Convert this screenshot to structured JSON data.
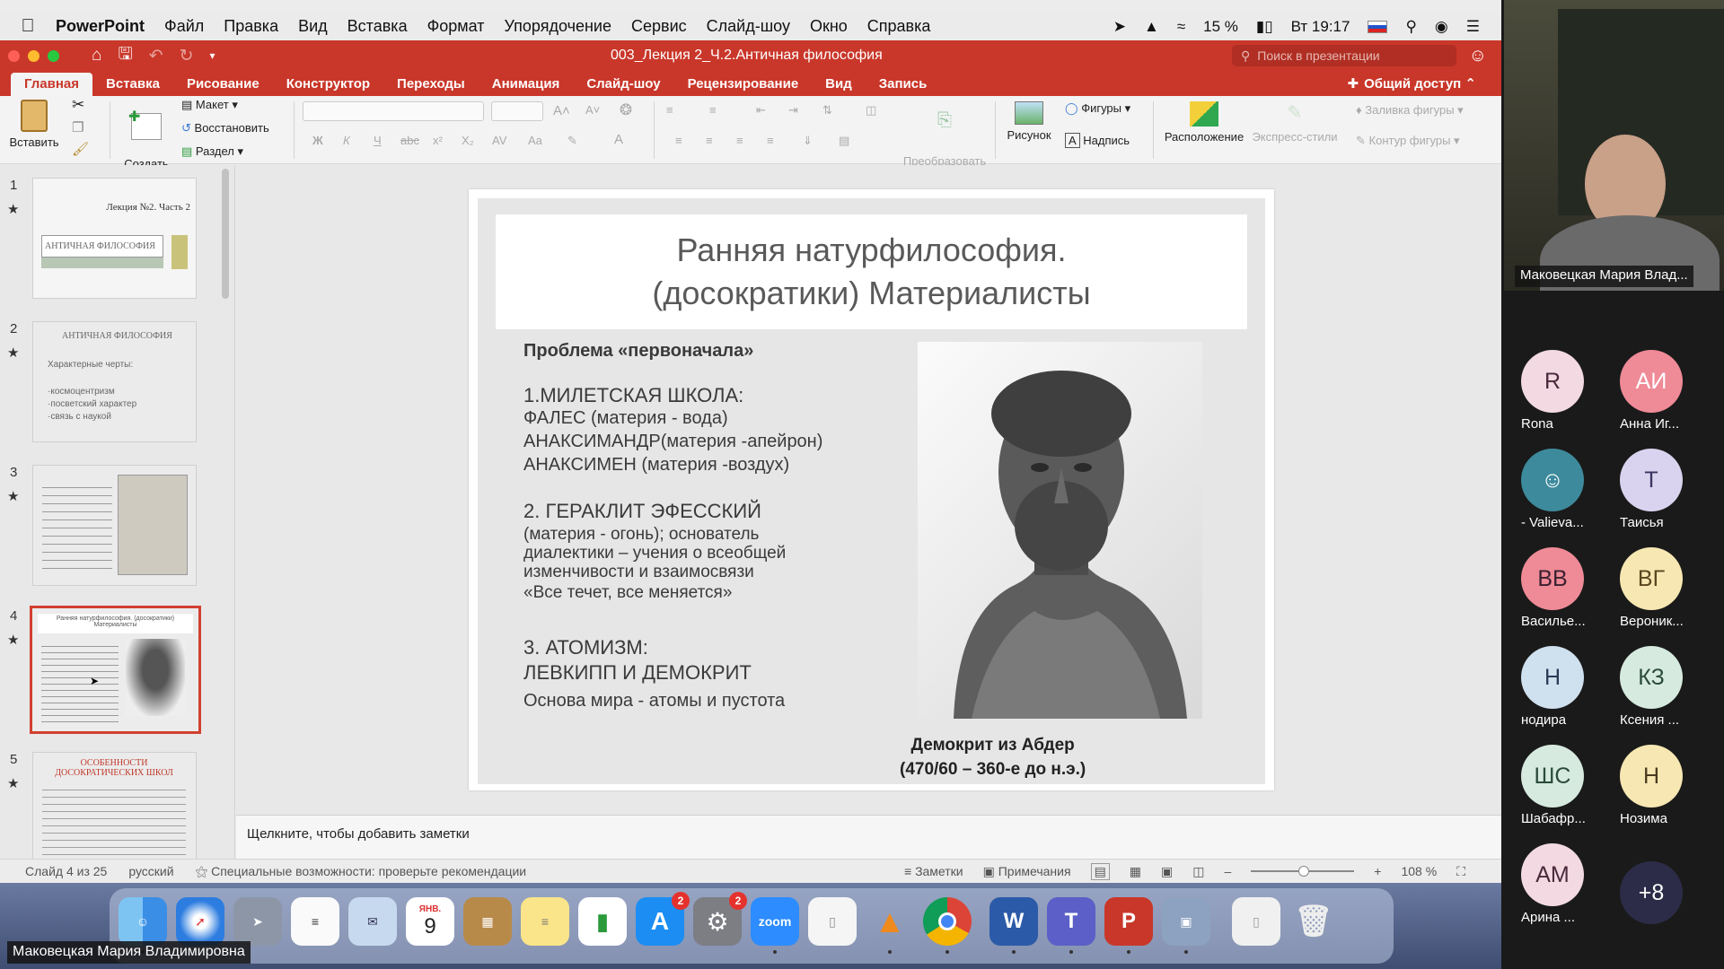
{
  "menubar": {
    "app": "PowerPoint",
    "items": [
      "Файл",
      "Правка",
      "Вид",
      "Вставка",
      "Формат",
      "Упорядочение",
      "Сервис",
      "Слайд-шоу",
      "Окно",
      "Справка"
    ],
    "battery": "15 %",
    "clock": "Вт 19:17"
  },
  "titlebar": {
    "title": "003_Лекция 2_Ч.2.Античная философия",
    "search_placeholder": "Поиск в презентации"
  },
  "ribbon": {
    "tabs": [
      "Главная",
      "Вставка",
      "Рисование",
      "Конструктор",
      "Переходы",
      "Анимация",
      "Слайд-шоу",
      "Рецензирование",
      "Вид",
      "Запись"
    ],
    "share": "Общий доступ",
    "paste": "Вставить",
    "new_slide": "Создать\nслайд",
    "layout": "Макет",
    "reset": "Восстановить",
    "section": "Раздел",
    "smartart": "Преобразовать\nв SmartArt",
    "picture": "Рисунок",
    "shapes": "Фигуры",
    "textbox": "Надпись",
    "arrange": "Расположение",
    "quick_styles": "Экспресс-стили",
    "shape_fill": "Заливка фигуры",
    "shape_outline": "Контур фигуры",
    "font_buttons": [
      "Ж",
      "К",
      "Ч",
      "abc",
      "x²",
      "X₂"
    ]
  },
  "thumbnails": [
    {
      "num": "1",
      "lines": [
        "Лекция №2. Часть 2",
        "АНТИЧНАЯ ФИЛОСОФИЯ"
      ]
    },
    {
      "num": "2",
      "lines": [
        "АНТИЧНАЯ ФИЛОСОФИЯ",
        "Характерные черты:",
        "·космоцентризм",
        "·посветский характер",
        "·связь с наукой"
      ]
    },
    {
      "num": "3",
      "lines": []
    },
    {
      "num": "4",
      "lines": [
        "Ранняя натурфилософия. (досократики) Материалисты"
      ]
    },
    {
      "num": "5",
      "lines": [
        "ОСОБЕННОСТИ ДОСОКРАТИЧЕСКИХ ШКОЛ"
      ]
    }
  ],
  "slide": {
    "title1": "Ранняя натурфилософия.",
    "title2": "(досократики)  Материалисты",
    "problem": "Проблема «первоначала»",
    "s1_head": "1.МИЛЕТСКАЯ ШКОЛА:",
    "s1_l1": "ФАЛЕС (материя - вода)",
    "s1_l2": "АНАКСИМАНДР(материя -апейрон)",
    "s1_l3": " АНАКСИМЕН (материя -воздух)",
    "s2_head": "2. ГЕРАКЛИТ ЭФЕССКИЙ",
    "s2_l1": "(материя - огонь); основатель",
    "s2_l2": " диалектики – учения о всеобщей",
    "s2_l3": " изменчивости и взаимосвязи",
    "s2_l4": "«Все течет, все меняется»",
    "s3_head": "3. АТОМИЗМ:",
    "s3_l1": "ЛЕВКИПП И ДЕМОКРИТ",
    "s3_l2": "Основа мира  - атомы и пустота",
    "caption1": "Демокрит из Абдер",
    "caption2": "(470/60 – 360-е до н.э.)"
  },
  "notes_placeholder": "Щелкните, чтобы добавить заметки",
  "statusbar": {
    "slide_info": "Слайд 4 из 25",
    "language": "русский",
    "accessibility": "Специальные возможности: проверьте рекомендации",
    "notes": "Заметки",
    "comments": "Примечания",
    "zoom": "108 %"
  },
  "dock": {
    "calendar_month": "ЯНВ.",
    "calendar_day": "9",
    "zoom_label": "zoom",
    "badge_appstore": "2",
    "badge_settings": "2"
  },
  "presenter_label": "Маковецкая Мария Владимировна",
  "video_name": "Маковецкая Мария Влад...",
  "participants": [
    {
      "initials": "R",
      "name": "Rona",
      "bg": "#f2d9e2",
      "fg": "#4a2a3a"
    },
    {
      "initials": "АИ",
      "name": "Анна Иг...",
      "bg": "#ef8a97",
      "fg": "#ffffff"
    },
    {
      "initials": "",
      "name": "- Valieva...",
      "bg": "#3d8a9c",
      "fg": "#ffffff"
    },
    {
      "initials": "Т",
      "name": "Таисья",
      "bg": "#d9d3ef",
      "fg": "#3a3460"
    },
    {
      "initials": "ВВ",
      "name": "Василье...",
      "bg": "#ef8a97",
      "fg": "#3a2030"
    },
    {
      "initials": "ВГ",
      "name": "Вероник...",
      "bg": "#f7e7b2",
      "fg": "#5a4520"
    },
    {
      "initials": "Н",
      "name": "нодира",
      "bg": "#cfe0ef",
      "fg": "#2a3a55"
    },
    {
      "initials": "КЗ",
      "name": "Ксения ...",
      "bg": "#d6eadf",
      "fg": "#2a4a3a"
    },
    {
      "initials": "ШС",
      "name": "Шабафр...",
      "bg": "#d6eadf",
      "fg": "#2a4a3a"
    },
    {
      "initials": "Н",
      "name": "Нозима",
      "bg": "#f7e7b2",
      "fg": "#4a3a20"
    },
    {
      "initials": "АМ",
      "name": "Арина ...",
      "bg": "#f2d9e2",
      "fg": "#4a2a3a"
    },
    {
      "initials": "+8",
      "name": "",
      "bg": "#2c2c48",
      "fg": "#ffffff"
    }
  ]
}
